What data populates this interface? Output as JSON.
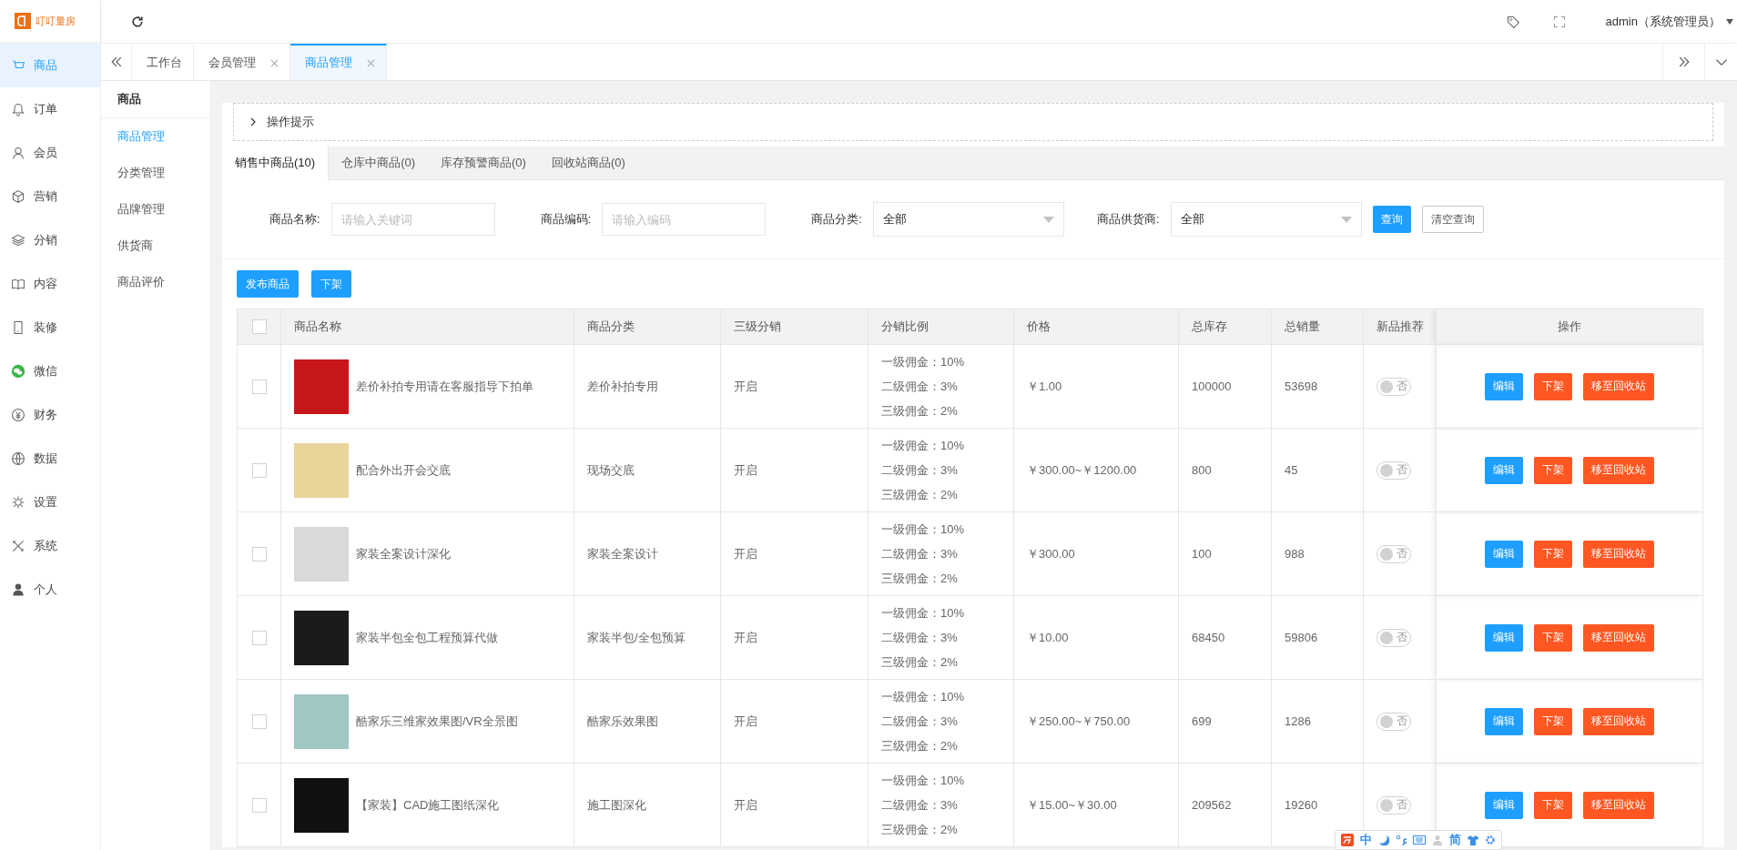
{
  "logo": {
    "text": "叮叮量房"
  },
  "sidebar": {
    "items": [
      {
        "label": "商品",
        "selected": true
      },
      {
        "label": "订单",
        "selected": false
      },
      {
        "label": "会员",
        "selected": false
      },
      {
        "label": "营销",
        "selected": false
      },
      {
        "label": "分销",
        "selected": false
      },
      {
        "label": "内容",
        "selected": false
      },
      {
        "label": "装修",
        "selected": false
      },
      {
        "label": "微信",
        "selected": false
      },
      {
        "label": "财务",
        "selected": false
      },
      {
        "label": "数据",
        "selected": false
      },
      {
        "label": "设置",
        "selected": false
      },
      {
        "label": "系统",
        "selected": false
      },
      {
        "label": "个人",
        "selected": false
      }
    ]
  },
  "topbar": {
    "user": "admin（系统管理员）"
  },
  "page_tabs": [
    {
      "label": "工作台",
      "closable": false,
      "selected": false
    },
    {
      "label": "会员管理",
      "closable": true,
      "selected": false
    },
    {
      "label": "商品管理",
      "closable": true,
      "selected": true
    }
  ],
  "subnav": {
    "title": "商品",
    "items": [
      {
        "label": "商品管理",
        "selected": true
      },
      {
        "label": "分类管理",
        "selected": false
      },
      {
        "label": "品牌管理",
        "selected": false
      },
      {
        "label": "供货商",
        "selected": false
      },
      {
        "label": "商品评价",
        "selected": false
      }
    ]
  },
  "hint": {
    "label": "操作提示",
    "expanded": false
  },
  "goods_tabs": [
    {
      "label": "销售中商品(10)",
      "selected": true
    },
    {
      "label": "仓库中商品(0)",
      "selected": false
    },
    {
      "label": "库存预警商品(0)",
      "selected": false
    },
    {
      "label": "回收站商品(0)",
      "selected": false
    }
  ],
  "filters": [
    {
      "kind": "input",
      "label": "商品名称:",
      "placeholder": "请输入关键词"
    },
    {
      "kind": "input",
      "label": "商品编码:",
      "placeholder": "请输入编码"
    },
    {
      "kind": "select",
      "label": "商品分类:",
      "value": "全部"
    },
    {
      "kind": "select",
      "label": "商品供货商:",
      "value": "全部"
    }
  ],
  "filter_buttons": [
    {
      "kind": "primary",
      "label": "查询"
    },
    {
      "kind": "plain",
      "label": "清空查询"
    }
  ],
  "action_buttons": [
    "发布商品",
    "下架"
  ],
  "table": {
    "select_all_checked": false,
    "columns": [
      "商品名称",
      "商品分类",
      "三级分销",
      "分销比例",
      "价格",
      "总库存",
      "总销量",
      "新品推荐",
      "操作"
    ],
    "rows": [
      {
        "checked": false,
        "name": "差价补拍专用请在客服指导下拍单",
        "category": "差价补拍专用",
        "distribution": "开启",
        "commissions": [
          "一级佣金：10%",
          "二级佣金：3%",
          "三级佣金：2%"
        ],
        "price": "￥1.00",
        "stock": "100000",
        "sales": "53698",
        "recommend": {
          "on": false,
          "label": "否"
        },
        "actions": [
          {
            "kind": "edit",
            "label": "编辑"
          },
          {
            "kind": "danger",
            "label": "下架"
          },
          {
            "kind": "danger",
            "label": "移至回收站"
          }
        ]
      },
      {
        "checked": false,
        "name": "配合外出开会交底",
        "category": "现场交底",
        "distribution": "开启",
        "commissions": [
          "一级佣金：10%",
          "二级佣金：3%",
          "三级佣金：2%"
        ],
        "price": "￥300.00~￥1200.00",
        "stock": "800",
        "sales": "45",
        "recommend": {
          "on": false,
          "label": "否"
        },
        "actions": [
          {
            "kind": "edit",
            "label": "编辑"
          },
          {
            "kind": "danger",
            "label": "下架"
          },
          {
            "kind": "danger",
            "label": "移至回收站"
          }
        ]
      },
      {
        "checked": false,
        "name": "家装全案设计深化",
        "category": "家装全案设计",
        "distribution": "开启",
        "commissions": [
          "一级佣金：10%",
          "二级佣金：3%",
          "三级佣金：2%"
        ],
        "price": "￥300.00",
        "stock": "100",
        "sales": "988",
        "recommend": {
          "on": false,
          "label": "否"
        },
        "actions": [
          {
            "kind": "edit",
            "label": "编辑"
          },
          {
            "kind": "danger",
            "label": "下架"
          },
          {
            "kind": "danger",
            "label": "移至回收站"
          }
        ]
      },
      {
        "checked": false,
        "name": "家装半包全包工程预算代做",
        "category": "家装半包/全包预算",
        "distribution": "开启",
        "commissions": [
          "一级佣金：10%",
          "二级佣金：3%",
          "三级佣金：2%"
        ],
        "price": "￥10.00",
        "stock": "68450",
        "sales": "59806",
        "recommend": {
          "on": false,
          "label": "否"
        },
        "actions": [
          {
            "kind": "edit",
            "label": "编辑"
          },
          {
            "kind": "danger",
            "label": "下架"
          },
          {
            "kind": "danger",
            "label": "移至回收站"
          }
        ]
      },
      {
        "checked": false,
        "name": "酷家乐三维家效果图/VR全景图",
        "category": "酷家乐效果图",
        "distribution": "开启",
        "commissions": [
          "一级佣金：10%",
          "二级佣金：3%",
          "三级佣金：2%"
        ],
        "price": "￥250.00~￥750.00",
        "stock": "699",
        "sales": "1286",
        "recommend": {
          "on": false,
          "label": "否"
        },
        "actions": [
          {
            "kind": "edit",
            "label": "编辑"
          },
          {
            "kind": "danger",
            "label": "下架"
          },
          {
            "kind": "danger",
            "label": "移至回收站"
          }
        ]
      },
      {
        "checked": false,
        "name": "【家装】CAD施工图纸深化",
        "category": "施工图深化",
        "distribution": "开启",
        "commissions": [
          "一级佣金：10%",
          "二级佣金：3%",
          "三级佣金：2%"
        ],
        "price": "￥15.00~￥30.00",
        "stock": "209562",
        "sales": "19260",
        "recommend": {
          "on": false,
          "label": "否"
        },
        "actions": [
          {
            "kind": "edit",
            "label": "编辑"
          },
          {
            "kind": "danger",
            "label": "下架"
          },
          {
            "kind": "danger",
            "label": "移至回收站"
          }
        ]
      }
    ]
  },
  "ime_toolbar": {
    "mode": "中",
    "script": "简"
  }
}
